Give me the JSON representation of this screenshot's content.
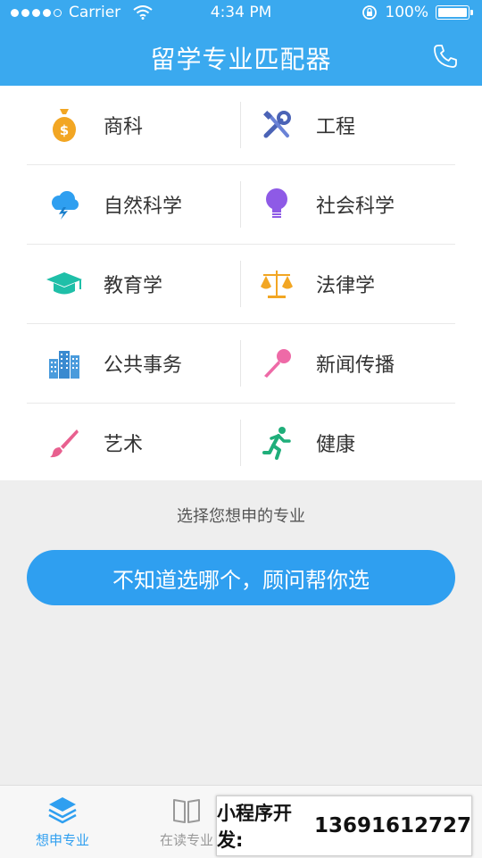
{
  "status_bar": {
    "carrier": "Carrier",
    "time": "4:34 PM",
    "battery": "100%"
  },
  "nav": {
    "title": "留学专业匹配器"
  },
  "categories": [
    {
      "label": "商科",
      "icon": "money-bag-icon"
    },
    {
      "label": "工程",
      "icon": "tools-icon"
    },
    {
      "label": "自然科学",
      "icon": "cloud-lightning-icon"
    },
    {
      "label": "社会科学",
      "icon": "lightbulb-icon"
    },
    {
      "label": "教育学",
      "icon": "graduation-cap-icon"
    },
    {
      "label": "法律学",
      "icon": "scales-icon"
    },
    {
      "label": "公共事务",
      "icon": "buildings-icon"
    },
    {
      "label": "新闻传播",
      "icon": "microphone-icon"
    },
    {
      "label": "艺术",
      "icon": "paintbrush-icon"
    },
    {
      "label": "健康",
      "icon": "running-person-icon"
    }
  ],
  "hint": "选择您想申的专业",
  "advisor_button": "不知道选哪个，顾问帮你选",
  "tabs": [
    {
      "label": "想申专业",
      "active": true
    },
    {
      "label": "在读专业",
      "active": false
    }
  ],
  "overlay": {
    "label": "小程序开发:",
    "phone": "13691612727"
  },
  "colors": {
    "brand": "#3aa9ef",
    "button": "#2f9ff0"
  }
}
